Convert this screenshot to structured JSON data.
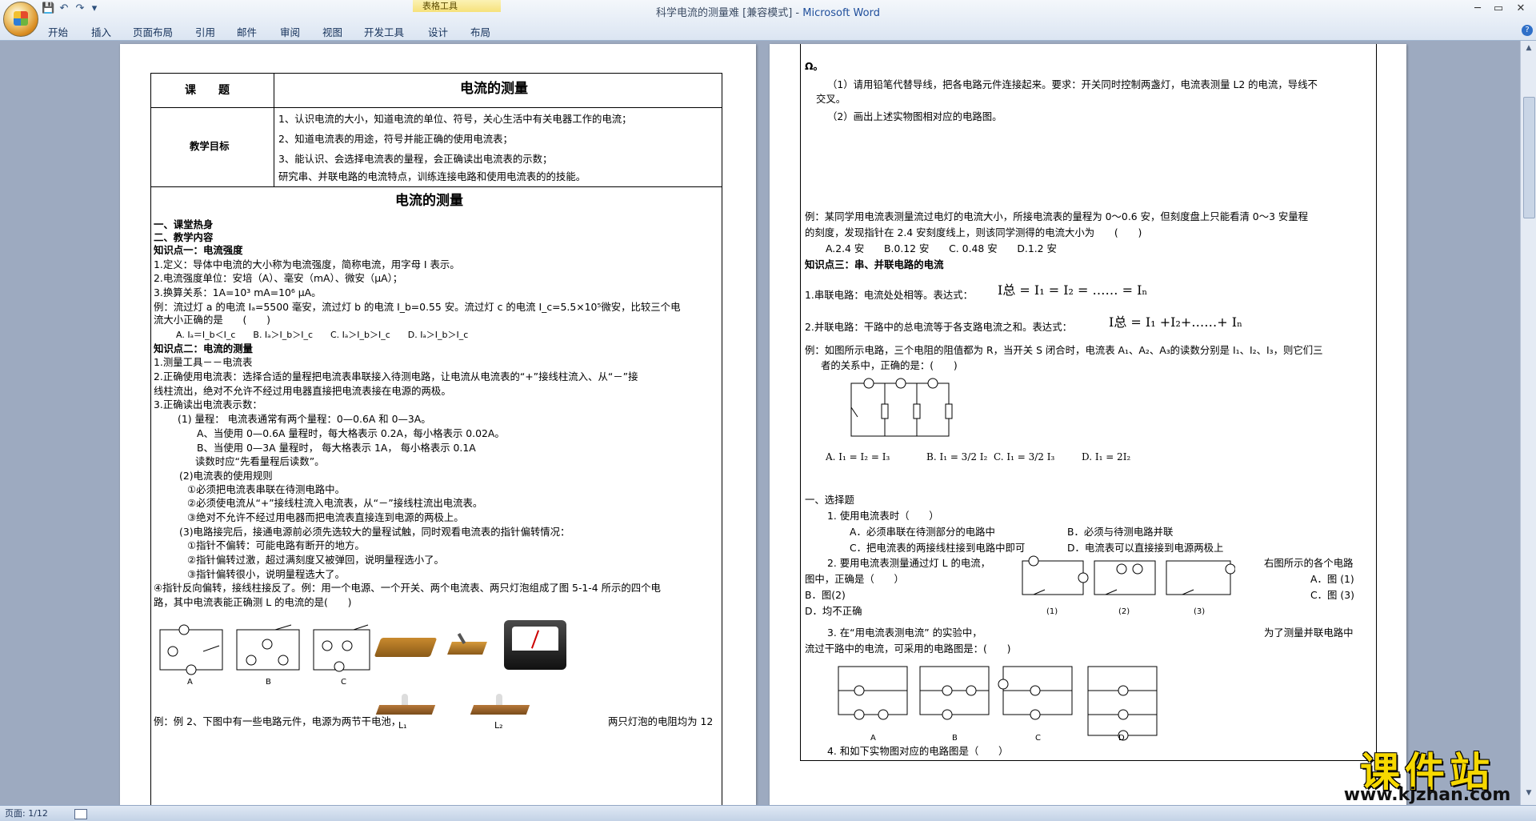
{
  "window": {
    "title_doc": "科学电流的测量难 [兼容模式] - ",
    "title_app": "Microsoft Word"
  },
  "ribbon": {
    "context_tab": "表格工具",
    "tabs": [
      "开始",
      "插入",
      "页面布局",
      "引用",
      "邮件",
      "审阅",
      "视图",
      "开发工具",
      "设计",
      "布局"
    ],
    "qat": {
      "save": "💾",
      "undo": "↶",
      "redo": "↷",
      "more": "▾"
    },
    "window_buttons": {
      "minimize": "─",
      "restore": "▭",
      "close": "✕"
    },
    "help": "?"
  },
  "status": {
    "page": "页面: 1/12"
  },
  "page1": {
    "table": {
      "r1_label": "课　　题",
      "r1_value": "电流的测量",
      "r2_label": "教学目标",
      "goals": [
        "1、认识电流的大小，知道电流的单位、符号，关心生活中有关电器工作的电流；",
        "2、知道电流表的用途，符号并能正确的使用电流表；",
        "3、能认识、会选择电流表的量程，会正确读出电流表的示数；",
        "研究串、并联电路的电流特点，训练连接电路和使用电流表的的技能。"
      ],
      "heading": "电流的测量"
    },
    "lines": [
      "一、课堂热身",
      "二、教学内容",
      "知识点一：电流强度",
      "1.定义：导体中电流的大小称为电流强度，简称电流，用字母 I 表示。",
      "2.电流强度单位：安培（A）、毫安（mA）、微安（μA）；",
      "3.换算关系：1A=10³ mA=10⁶ μA。",
      "例：流过灯 a 的电流 Iₐ=5500 毫安，流过灯 b 的电流 I_b=0.55 安。流过灯 c 的电流 I_c=5.5×10⁵微安，比较三个电",
      "流大小正确的是　　(　　)",
      "A. Iₐ＝I_b＜I_c　　B. Iₐ＞I_b＞I_c　　C. Iₐ＞I_b＞I_c　　D. Iₐ＞I_b＞I_c",
      "知识点二：电流的测量",
      "1.测量工具－－电流表",
      "2.正确使用电流表：选择合适的量程把电流表串联接入待测电路，让电流从电流表的“+”接线柱流入、从“－”接",
      "线柱流出，绝对不允许不经过用电器直接把电流表接在电源的两极。",
      "3.正确读出电流表示数：",
      "(1)  量程：  电流表通常有两个量程：0—0.6A 和 0—3A。",
      "A、当使用 0—0.6A 量程时，每大格表示 0.2A，每小格表示 0.02A。",
      "B、当使用 0—3A 量程时，   每大格表示 1A，   每小格表示 0.1A",
      "读数时应“先看量程后读数”。",
      "(2)电流表的使用规则",
      "①必须把电流表串联在待测电路中。",
      "②必须使电流从“+”接线柱流入电流表，从“－”接线柱流出电流表。",
      "③绝对不允许不经过用电器而把电流表直接连到电源的两极上。",
      "(3)电路接完后，接通电源前必须先选较大的量程试触，同时观看电流表的指针偏转情况：",
      "①指针不偏转：可能电路有断开的地方。",
      "②指针偏转过激，超过满刻度又被弹回，说明量程选小了。",
      "③指针偏转很小，说明量程选大了。",
      "④指针反向偏转，接线柱接反了。例：用一个电源、一个开关、两个电流表、两只灯泡组成了图 5-1-4 所示的四个电",
      "路，其中电流表能正确测 L 的电流的是(　　)"
    ],
    "fig_labels": [
      "A",
      "B",
      "C"
    ],
    "lamp_labels": [
      "L₁",
      "L₂"
    ],
    "bottom_left": "例：例 2、下图中有一些电路元件，电源为两节干电池，",
    "bottom_right": "两只灯泡的电阻均为 12"
  },
  "page2": {
    "lines": [
      "Ω。",
      "（1）请用铅笔代替导线，把各电路元件连接起来。要求：开关同时控制两盏灯，电流表测量 L2 的电流，导线不",
      "交叉。",
      "（2）画出上述实物图相对应的电路图。",
      "例：某同学用电流表测量流过电灯的电流大小，所接电流表的量程为 0～0.6 安，但刻度盘上只能看清 0～3 安量程",
      "的刻度，发现指针在 2.4 安刻度线上，则该同学测得的电流大小为　　(　　)",
      "A.2.4 安　　B.0.12 安　　C. 0.48 安　　D.1.2 安",
      "知识点三：串、并联电路的电流",
      "1.串联电路：电流处处相等。表达式：",
      "2.并联电路：干路中的总电流等于各支路电流之和。表达式：",
      "例：如图所示电路，三个电阻的阻值都为 R，当开关 S 闭合时，电流表 A₁、A₂、A₃的读数分别是 I₁、I₂、I₃，则它们三",
      "者的关系中，正确的是：(　　)",
      "一、选择题",
      "1. 使用电流表时（　　）",
      "A．必须串联在待测部分的电路中",
      "B．必须与待测电路并联",
      "C．把电流表的两接线柱接到电路中即可",
      "D．电流表可以直接接到电源两极上",
      "2. 要用电流表测量通过灯 L 的电流，",
      "右图所示的各个电路",
      "图中，正确是（　　）",
      "A．图 (1)",
      "B．图(2)",
      "C．图 (3)",
      "D．均不正确",
      "3. 在“用电流表测电流” 的实验中，",
      "为了测量并联电路中",
      "流过干路中的电流，可采用的电路图是：(　　)",
      "4. 和如下实物图对应的电路图是（　　）"
    ],
    "formula_series": "I总 = I₁ = I₂ = …… = Iₙ",
    "formula_parallel": "I总 = I₁ +I₂+……+ Iₙ",
    "options_currents": [
      "A. I₁ = I₂ = I₃",
      "B. I₁ = 3/2 I₂",
      "C. I₁ = 3/2 I₃",
      "D. I₁ = 2I₂"
    ],
    "fig_labels_q2": [
      "(1)",
      "(2)",
      "(3)"
    ],
    "fig_labels_q3": [
      "A",
      "B",
      "C",
      "D"
    ]
  },
  "watermark": {
    "main": "课件站",
    "url": "www.kjzhan.com"
  }
}
